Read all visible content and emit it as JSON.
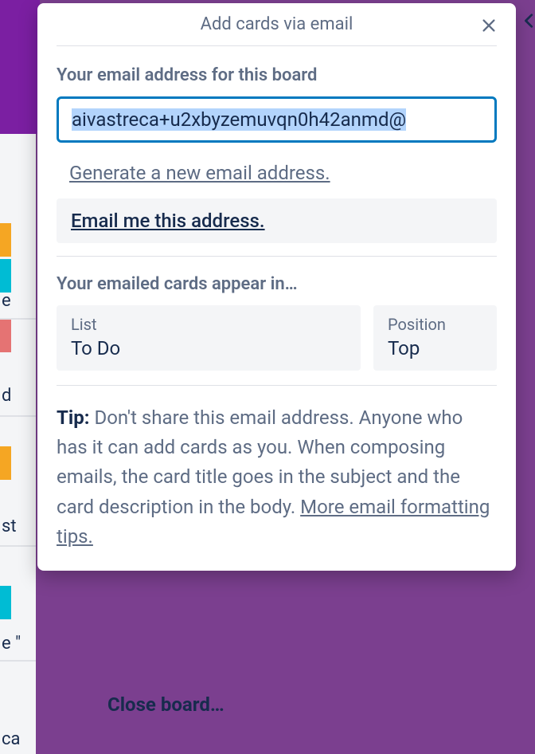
{
  "header": {
    "title": "Add cards via email"
  },
  "section": {
    "email_label": "Your email address for this board",
    "email_value": "aivastreca+u2xbyzemuvqn0h42anmd@",
    "generate_link": "Generate a new email address.",
    "email_me_link": "Email me this address.",
    "appear_label": "Your emailed cards appear in…",
    "list": {
      "label": "List",
      "value": "To Do"
    },
    "position": {
      "label": "Position",
      "value": "Top"
    }
  },
  "tip": {
    "prefix": "Tip:",
    "body": " Don't share this email address. Anyone who has it can add cards as you. When composing emails, the card title goes in the subject and the card description in the body. ",
    "more_link": "More email formatting tips."
  },
  "background": {
    "close_board": "Close board…",
    "side1": "e",
    "side2": "d",
    "side3": "st",
    "side4": "e \"",
    "side5": "ca"
  }
}
